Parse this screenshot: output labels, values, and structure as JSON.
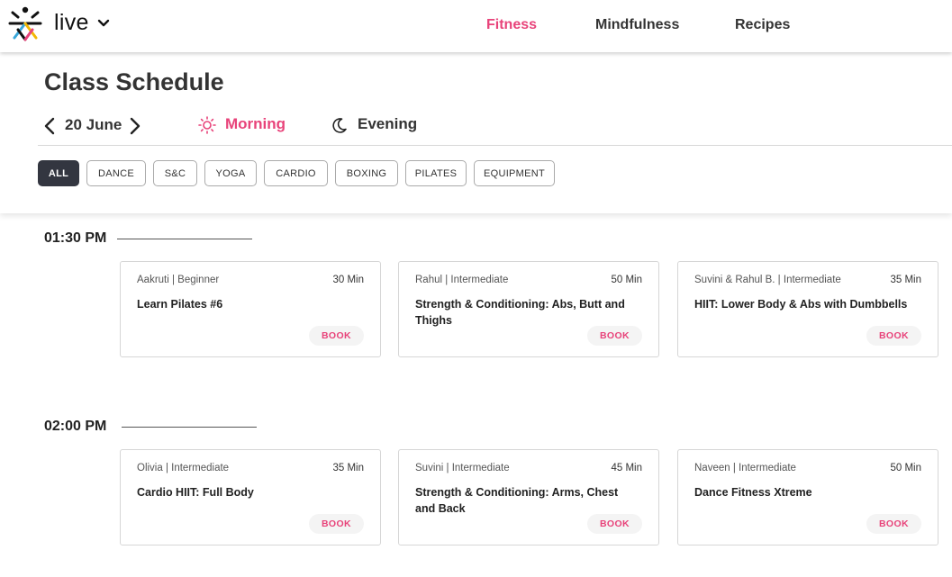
{
  "app": {
    "brand": "live"
  },
  "nav": {
    "items": [
      {
        "label": "Fitness",
        "active": true
      },
      {
        "label": "Mindfulness",
        "active": false
      },
      {
        "label": "Recipes",
        "active": false
      }
    ]
  },
  "schedule": {
    "title": "Class Schedule",
    "date": "20 June",
    "slots": [
      {
        "label": "Morning",
        "icon": "sun-icon",
        "active": true
      },
      {
        "label": "Evening",
        "icon": "moon-icon",
        "active": false
      }
    ],
    "filters": [
      "ALL",
      "DANCE",
      "S&C",
      "YOGA",
      "CARDIO",
      "BOXING",
      "PILATES",
      "EQUIPMENT"
    ],
    "active_filter": "ALL"
  },
  "groups": [
    {
      "time": "01:30 PM",
      "classes": [
        {
          "trainer": "Aakruti | Beginner",
          "duration": "30 Min",
          "title": "Learn Pilates #6",
          "action": "BOOK"
        },
        {
          "trainer": "Rahul | Intermediate",
          "duration": "50 Min",
          "title": "Strength & Conditioning: Abs, Butt and Thighs",
          "action": "BOOK"
        },
        {
          "trainer": "Suvini & Rahul B. | Intermediate",
          "duration": "35 Min",
          "title": "HIIT: Lower Body & Abs with Dumbbells",
          "action": "BOOK"
        }
      ]
    },
    {
      "time": "02:00 PM",
      "classes": [
        {
          "trainer": "Olivia | Intermediate",
          "duration": "35 Min",
          "title": "Cardio HIIT: Full Body",
          "action": "BOOK"
        },
        {
          "trainer": "Suvini | Intermediate",
          "duration": "45 Min",
          "title": "Strength & Conditioning: Arms, Chest and Back",
          "action": "BOOK"
        },
        {
          "trainer": "Naveen | Intermediate",
          "duration": "50 Min",
          "title": "Dance Fitness Xtreme",
          "action": "BOOK"
        }
      ]
    }
  ],
  "colors": {
    "accent": "#e8437a",
    "chip_active": "#333640",
    "text": "#333333"
  }
}
